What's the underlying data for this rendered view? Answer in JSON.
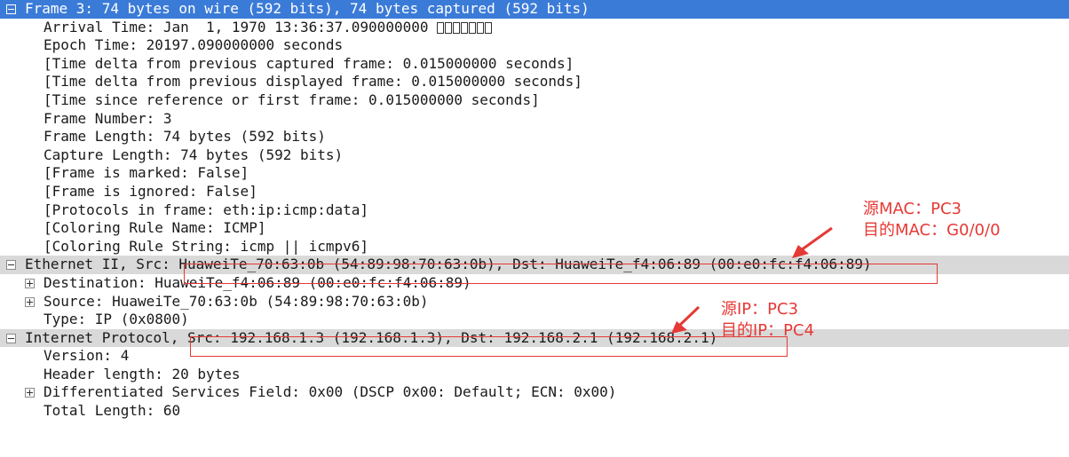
{
  "frame": {
    "header": "Frame 3: 74 bytes on wire (592 bits), 74 bytes captured (592 bits)",
    "arrival_time": "Arrival Time: Jan  1, 1970 13:36:37.090000000",
    "epoch_time": "Epoch Time: 20197.090000000 seconds",
    "delta_captured": "[Time delta from previous captured frame: 0.015000000 seconds]",
    "delta_displayed": "[Time delta from previous displayed frame: 0.015000000 seconds]",
    "time_since_ref": "[Time since reference or first frame: 0.015000000 seconds]",
    "frame_number": "Frame Number: 3",
    "frame_length": "Frame Length: 74 bytes (592 bits)",
    "capture_length": "Capture Length: 74 bytes (592 bits)",
    "marked": "[Frame is marked: False]",
    "ignored": "[Frame is ignored: False]",
    "protocols": "[Protocols in frame: eth:ip:icmp:data]",
    "coloring_name": "[Coloring Rule Name: ICMP]",
    "coloring_string": "[Coloring Rule String: icmp || icmpv6]"
  },
  "ethernet": {
    "prefix": "Ethernet II, Src: ",
    "detail": "HuaweiTe_70:63:0b (54:89:98:70:63:0b), Dst: HuaweiTe_f4:06:89 (00:e0:fc:f4:06:89)",
    "destination": "Destination: HuaweiTe_f4:06:89 (00:e0:fc:f4:06:89)",
    "source": "Source: HuaweiTe_70:63:0b (54:89:98:70:63:0b)",
    "type": "Type: IP (0x0800)"
  },
  "ip": {
    "prefix": "Internet Protocol, ",
    "detail": "Src: 192.168.1.3 (192.168.1.3), Dst: 192.168.2.1 (192.168.2.1)",
    "version": "Version: 4",
    "header_length": "Header length: 20 bytes",
    "dsf": "Differentiated Services Field: 0x00 (DSCP 0x00: Default; ECN: 0x00)",
    "total_length": "Total Length: 60"
  },
  "annotations": {
    "mac_src": "源MAC：PC3",
    "mac_dst": "目的MAC：G0/0/0",
    "ip_src": "源IP：PC3",
    "ip_dst": "目的IP：PC4",
    "color": "#e53935"
  },
  "colors": {
    "selected_row": "#3b7bd8",
    "shaded_row": "#d9d9d9"
  }
}
